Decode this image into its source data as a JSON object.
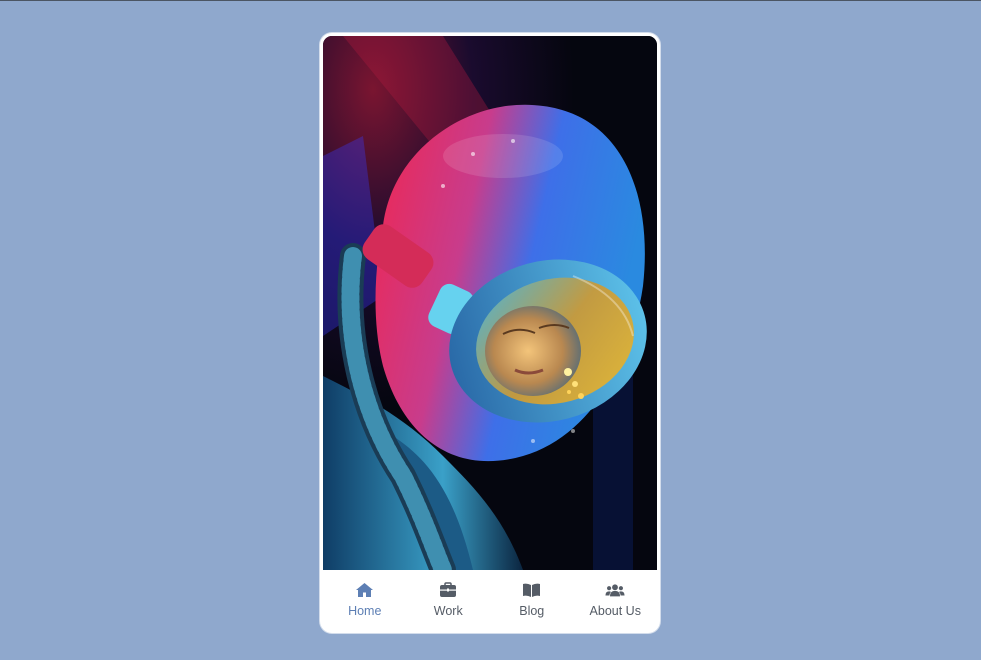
{
  "colors": {
    "background": "#8fa8cd",
    "card": "#ffffff",
    "active": "#5d7fb4",
    "inactive": "#555c66"
  },
  "photo": {
    "icon": "astronaut-photo"
  },
  "nav": {
    "items": [
      {
        "label": "Home",
        "icon": "home-icon",
        "active": true
      },
      {
        "label": "Work",
        "icon": "briefcase-icon",
        "active": false
      },
      {
        "label": "Blog",
        "icon": "book-icon",
        "active": false
      },
      {
        "label": "About Us",
        "icon": "users-icon",
        "active": false
      }
    ]
  }
}
